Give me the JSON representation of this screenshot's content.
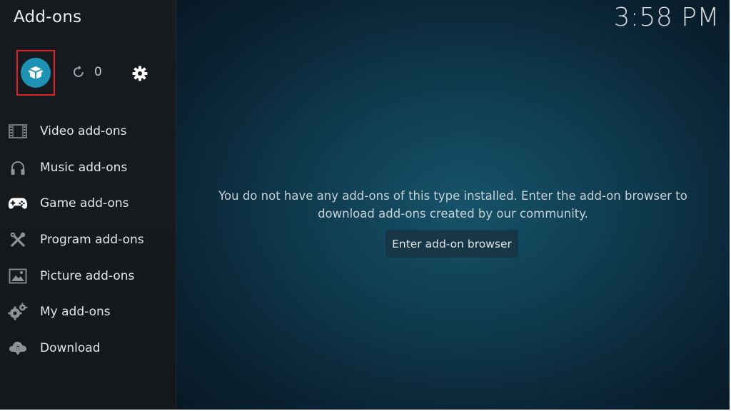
{
  "header": {
    "title": "Add-ons",
    "clock": "3:58 PM"
  },
  "toolbar": {
    "addon_browser_icon": "open-box-icon",
    "updates_icon": "refresh-icon",
    "updates_count": "0",
    "settings_icon": "gear-icon",
    "highlight_color": "#e0232a",
    "browser_button_color": "#1d92b3"
  },
  "sidebar": {
    "items": [
      {
        "label": "Video add-ons",
        "icon": "film-strip-icon"
      },
      {
        "label": "Music add-ons",
        "icon": "headphones-icon"
      },
      {
        "label": "Game add-ons",
        "icon": "gamepad-icon"
      },
      {
        "label": "Program add-ons",
        "icon": "tools-icon"
      },
      {
        "label": "Picture add-ons",
        "icon": "picture-icon"
      },
      {
        "label": "My add-ons",
        "icon": "gears-icon"
      },
      {
        "label": "Download",
        "icon": "cloud-download-icon"
      }
    ]
  },
  "main": {
    "message_line1": "You do not have any add-ons of this type installed. Enter the add-on browser to",
    "message_line2": "download add-ons created by our community.",
    "button_label": "Enter add-on browser"
  }
}
